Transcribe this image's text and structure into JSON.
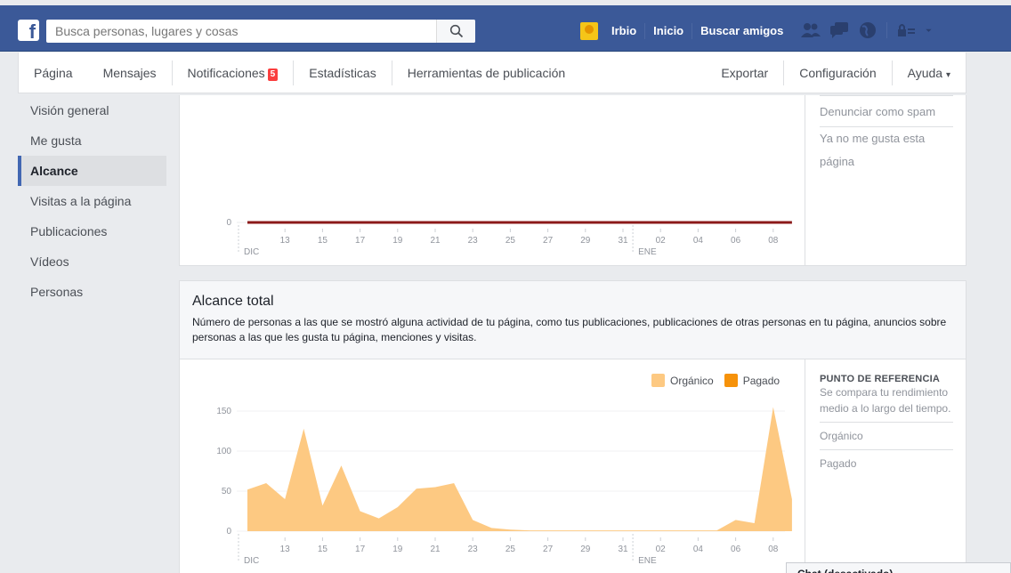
{
  "topbar": {
    "search_placeholder": "Busca personas, lugares y cosas",
    "username": "Irbio",
    "nav": [
      "Inicio",
      "Buscar amigos"
    ],
    "icons": [
      "friends-icon",
      "messages-icon",
      "globe-icon",
      "privacy-icon",
      "dropdown-icon"
    ],
    "color": "#3b5998"
  },
  "pagenav": {
    "pagina": "Página",
    "mensajes": "Mensajes",
    "notificaciones": "Notificaciones",
    "notif_count": "5",
    "estadisticas": "Estadísticas",
    "herramientas": "Herramientas de publicación",
    "exportar": "Exportar",
    "configuracion": "Configuración",
    "ayuda": "Ayuda",
    "ayuda_caret": "▾"
  },
  "sidebar": {
    "items": [
      {
        "label": "Visión general"
      },
      {
        "label": "Me gusta"
      },
      {
        "label": "Alcance"
      },
      {
        "label": "Visitas a la página"
      },
      {
        "label": "Publicaciones"
      },
      {
        "label": "Vídeos"
      },
      {
        "label": "Personas"
      }
    ],
    "active": "Alcance"
  },
  "card1": {
    "right_items": [
      "Denunciar como spam",
      "Ya no me gusta esta página"
    ]
  },
  "card2": {
    "title": "Alcance total",
    "description": "Número de personas a las que se mostró alguna actividad de tu página, como tus publicaciones, publicaciones de otras personas en tu página, anuncios sobre personas a las que les gusta tu página, menciones y visitas.",
    "ref_title": "PUNTO DE REFERENCIA",
    "ref_desc": "Se compara tu rendimiento medio a lo largo del tiempo.",
    "ref_items": [
      "Orgánico",
      "Pagado"
    ]
  },
  "chat": {
    "label": "Chat (desactivado)"
  },
  "chart_data": [
    {
      "type": "line",
      "x_tick_labels": [
        "13",
        "15",
        "17",
        "19",
        "21",
        "23",
        "25",
        "27",
        "29",
        "31",
        "02",
        "04",
        "06",
        "08"
      ],
      "month_labels": [
        "DIC",
        "ENE"
      ],
      "y_tick_labels": [
        "0"
      ],
      "series": [
        {
          "color": "#8b1a1a",
          "values": [
            0,
            0,
            0,
            0,
            0,
            0,
            0,
            0,
            0,
            0,
            0,
            0,
            0,
            0,
            0,
            0,
            0,
            0,
            0,
            0,
            0,
            0,
            0,
            0,
            0,
            0,
            0,
            0,
            0,
            0
          ]
        }
      ]
    },
    {
      "type": "area",
      "x_tick_labels": [
        "13",
        "15",
        "17",
        "19",
        "21",
        "23",
        "25",
        "27",
        "29",
        "31",
        "02",
        "04",
        "06",
        "08"
      ],
      "month_labels": [
        "DIC",
        "ENE"
      ],
      "ylim": [
        0,
        165
      ],
      "y_ticks": [
        0,
        50,
        100,
        150
      ],
      "legend": [
        {
          "name": "Orgánico",
          "color": "#fdc982"
        },
        {
          "name": "Pagado",
          "color": "#f6920a"
        }
      ],
      "series": [
        {
          "name": "Orgánico",
          "color": "#fdc982",
          "values": [
            52,
            60,
            40,
            128,
            32,
            82,
            25,
            16,
            30,
            53,
            55,
            60,
            14,
            4,
            2,
            1,
            1,
            1,
            1,
            1,
            1,
            1,
            1,
            1,
            1,
            1,
            14,
            10,
            155,
            40
          ]
        },
        {
          "name": "Pagado",
          "color": "#f6920a",
          "values": [
            0,
            0,
            0,
            0,
            0,
            0,
            0,
            0,
            0,
            0,
            0,
            0,
            0,
            0,
            0,
            0,
            0,
            0,
            0,
            0,
            0,
            0,
            0,
            0,
            0,
            0,
            0,
            0,
            0,
            0
          ]
        }
      ]
    }
  ]
}
